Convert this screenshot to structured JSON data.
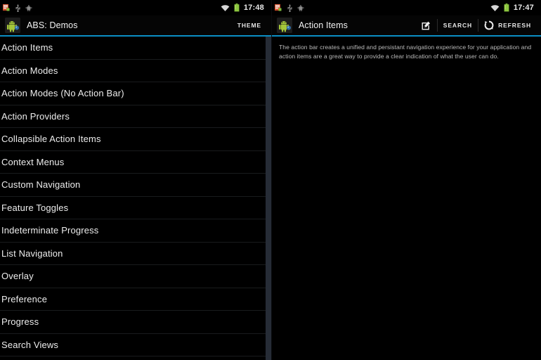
{
  "left_pane": {
    "status_bar": {
      "icons": [
        "notification-icon",
        "usb-icon",
        "debug-icon"
      ],
      "wifi_icon": "wifi-icon",
      "battery_icon": "battery-icon",
      "time": "17:48"
    },
    "action_bar": {
      "app_icon": "android-app-icon",
      "title": "ABS: Demos",
      "theme_label": "THEME"
    },
    "list": {
      "items": [
        {
          "label": "Action Items"
        },
        {
          "label": "Action Modes"
        },
        {
          "label": "Action Modes (No Action Bar)"
        },
        {
          "label": "Action Providers"
        },
        {
          "label": "Collapsible Action Items"
        },
        {
          "label": "Context Menus"
        },
        {
          "label": "Custom Navigation"
        },
        {
          "label": "Feature Toggles"
        },
        {
          "label": "Indeterminate Progress"
        },
        {
          "label": "List Navigation"
        },
        {
          "label": "Overlay"
        },
        {
          "label": "Preference"
        },
        {
          "label": "Progress"
        },
        {
          "label": "Search Views"
        }
      ]
    }
  },
  "right_pane": {
    "status_bar": {
      "icons": [
        "notification-icon",
        "usb-icon",
        "debug-icon"
      ],
      "wifi_icon": "wifi-icon",
      "battery_icon": "battery-icon",
      "time": "17:47"
    },
    "action_bar": {
      "app_icon": "android-app-icon",
      "title": "Action Items",
      "actions": [
        {
          "name": "compose",
          "icon": "compose-icon",
          "label": ""
        },
        {
          "name": "search",
          "icon": "",
          "label": "SEARCH"
        },
        {
          "name": "refresh",
          "icon": "refresh-icon",
          "label": "REFRESH"
        }
      ]
    },
    "body": {
      "text": "The action bar creates a unified and persistant navigation experience for your application and action items are a great way to provide a clear indication of what the user can do."
    }
  },
  "colors": {
    "accent": "#0b8ec4",
    "background": "#000000",
    "divider": "#191b1d",
    "scrollbar": "#262c36",
    "battery_green": "#8cc63f"
  }
}
